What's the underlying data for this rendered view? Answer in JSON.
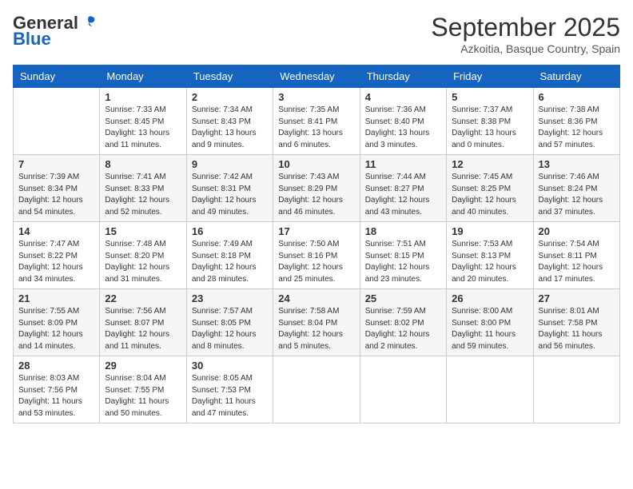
{
  "header": {
    "logo_general": "General",
    "logo_blue": "Blue",
    "month": "September 2025",
    "location": "Azkoitia, Basque Country, Spain"
  },
  "weekdays": [
    "Sunday",
    "Monday",
    "Tuesday",
    "Wednesday",
    "Thursday",
    "Friday",
    "Saturday"
  ],
  "weeks": [
    [
      {
        "day": "",
        "info": ""
      },
      {
        "day": "1",
        "info": "Sunrise: 7:33 AM\nSunset: 8:45 PM\nDaylight: 13 hours\nand 11 minutes."
      },
      {
        "day": "2",
        "info": "Sunrise: 7:34 AM\nSunset: 8:43 PM\nDaylight: 13 hours\nand 9 minutes."
      },
      {
        "day": "3",
        "info": "Sunrise: 7:35 AM\nSunset: 8:41 PM\nDaylight: 13 hours\nand 6 minutes."
      },
      {
        "day": "4",
        "info": "Sunrise: 7:36 AM\nSunset: 8:40 PM\nDaylight: 13 hours\nand 3 minutes."
      },
      {
        "day": "5",
        "info": "Sunrise: 7:37 AM\nSunset: 8:38 PM\nDaylight: 13 hours\nand 0 minutes."
      },
      {
        "day": "6",
        "info": "Sunrise: 7:38 AM\nSunset: 8:36 PM\nDaylight: 12 hours\nand 57 minutes."
      }
    ],
    [
      {
        "day": "7",
        "info": "Sunrise: 7:39 AM\nSunset: 8:34 PM\nDaylight: 12 hours\nand 54 minutes."
      },
      {
        "day": "8",
        "info": "Sunrise: 7:41 AM\nSunset: 8:33 PM\nDaylight: 12 hours\nand 52 minutes."
      },
      {
        "day": "9",
        "info": "Sunrise: 7:42 AM\nSunset: 8:31 PM\nDaylight: 12 hours\nand 49 minutes."
      },
      {
        "day": "10",
        "info": "Sunrise: 7:43 AM\nSunset: 8:29 PM\nDaylight: 12 hours\nand 46 minutes."
      },
      {
        "day": "11",
        "info": "Sunrise: 7:44 AM\nSunset: 8:27 PM\nDaylight: 12 hours\nand 43 minutes."
      },
      {
        "day": "12",
        "info": "Sunrise: 7:45 AM\nSunset: 8:25 PM\nDaylight: 12 hours\nand 40 minutes."
      },
      {
        "day": "13",
        "info": "Sunrise: 7:46 AM\nSunset: 8:24 PM\nDaylight: 12 hours\nand 37 minutes."
      }
    ],
    [
      {
        "day": "14",
        "info": "Sunrise: 7:47 AM\nSunset: 8:22 PM\nDaylight: 12 hours\nand 34 minutes."
      },
      {
        "day": "15",
        "info": "Sunrise: 7:48 AM\nSunset: 8:20 PM\nDaylight: 12 hours\nand 31 minutes."
      },
      {
        "day": "16",
        "info": "Sunrise: 7:49 AM\nSunset: 8:18 PM\nDaylight: 12 hours\nand 28 minutes."
      },
      {
        "day": "17",
        "info": "Sunrise: 7:50 AM\nSunset: 8:16 PM\nDaylight: 12 hours\nand 25 minutes."
      },
      {
        "day": "18",
        "info": "Sunrise: 7:51 AM\nSunset: 8:15 PM\nDaylight: 12 hours\nand 23 minutes."
      },
      {
        "day": "19",
        "info": "Sunrise: 7:53 AM\nSunset: 8:13 PM\nDaylight: 12 hours\nand 20 minutes."
      },
      {
        "day": "20",
        "info": "Sunrise: 7:54 AM\nSunset: 8:11 PM\nDaylight: 12 hours\nand 17 minutes."
      }
    ],
    [
      {
        "day": "21",
        "info": "Sunrise: 7:55 AM\nSunset: 8:09 PM\nDaylight: 12 hours\nand 14 minutes."
      },
      {
        "day": "22",
        "info": "Sunrise: 7:56 AM\nSunset: 8:07 PM\nDaylight: 12 hours\nand 11 minutes."
      },
      {
        "day": "23",
        "info": "Sunrise: 7:57 AM\nSunset: 8:05 PM\nDaylight: 12 hours\nand 8 minutes."
      },
      {
        "day": "24",
        "info": "Sunrise: 7:58 AM\nSunset: 8:04 PM\nDaylight: 12 hours\nand 5 minutes."
      },
      {
        "day": "25",
        "info": "Sunrise: 7:59 AM\nSunset: 8:02 PM\nDaylight: 12 hours\nand 2 minutes."
      },
      {
        "day": "26",
        "info": "Sunrise: 8:00 AM\nSunset: 8:00 PM\nDaylight: 11 hours\nand 59 minutes."
      },
      {
        "day": "27",
        "info": "Sunrise: 8:01 AM\nSunset: 7:58 PM\nDaylight: 11 hours\nand 56 minutes."
      }
    ],
    [
      {
        "day": "28",
        "info": "Sunrise: 8:03 AM\nSunset: 7:56 PM\nDaylight: 11 hours\nand 53 minutes."
      },
      {
        "day": "29",
        "info": "Sunrise: 8:04 AM\nSunset: 7:55 PM\nDaylight: 11 hours\nand 50 minutes."
      },
      {
        "day": "30",
        "info": "Sunrise: 8:05 AM\nSunset: 7:53 PM\nDaylight: 11 hours\nand 47 minutes."
      },
      {
        "day": "",
        "info": ""
      },
      {
        "day": "",
        "info": ""
      },
      {
        "day": "",
        "info": ""
      },
      {
        "day": "",
        "info": ""
      }
    ]
  ]
}
